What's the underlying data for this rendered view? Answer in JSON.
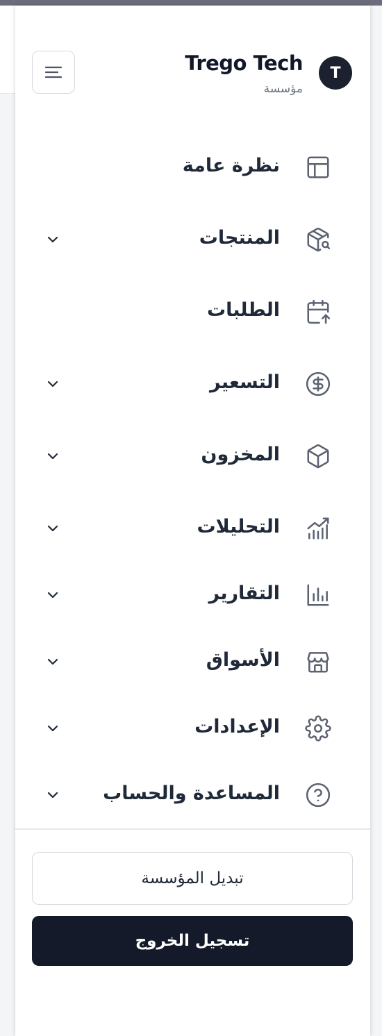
{
  "header": {
    "avatar_initial": "T",
    "org_name": "Trego Tech",
    "org_type": "مؤسسة",
    "menu_toggle_icon": "menu-lines-icon"
  },
  "nav": {
    "items": [
      {
        "label": "نظرة عامة",
        "icon": "layout-icon",
        "has_submenu": false
      },
      {
        "label": "المنتجات",
        "icon": "package-search-icon",
        "has_submenu": true
      },
      {
        "label": "الطلبات",
        "icon": "calendar-arrow-icon",
        "has_submenu": false
      },
      {
        "label": "التسعير",
        "icon": "dollar-circle-icon",
        "has_submenu": true
      },
      {
        "label": "المخزون",
        "icon": "box-icon",
        "has_submenu": true
      },
      {
        "label": "التحليلات",
        "icon": "chart-trend-icon",
        "has_submenu": true
      },
      {
        "label": "التقارير",
        "icon": "bar-chart-icon",
        "has_submenu": true
      },
      {
        "label": "الأسواق",
        "icon": "store-icon",
        "has_submenu": true
      },
      {
        "label": "الإعدادات",
        "icon": "gear-icon",
        "has_submenu": true
      },
      {
        "label": "المساعدة والحساب",
        "icon": "help-circle-icon",
        "has_submenu": true
      }
    ]
  },
  "footer": {
    "switch_org_label": "تبديل المؤسسة",
    "logout_label": "تسجيل الخروج"
  },
  "colors": {
    "primary_dark": "#141a29",
    "text": "#1f2937",
    "muted": "#6b7280",
    "icon": "#5b6270",
    "border": "#d6d9de"
  }
}
